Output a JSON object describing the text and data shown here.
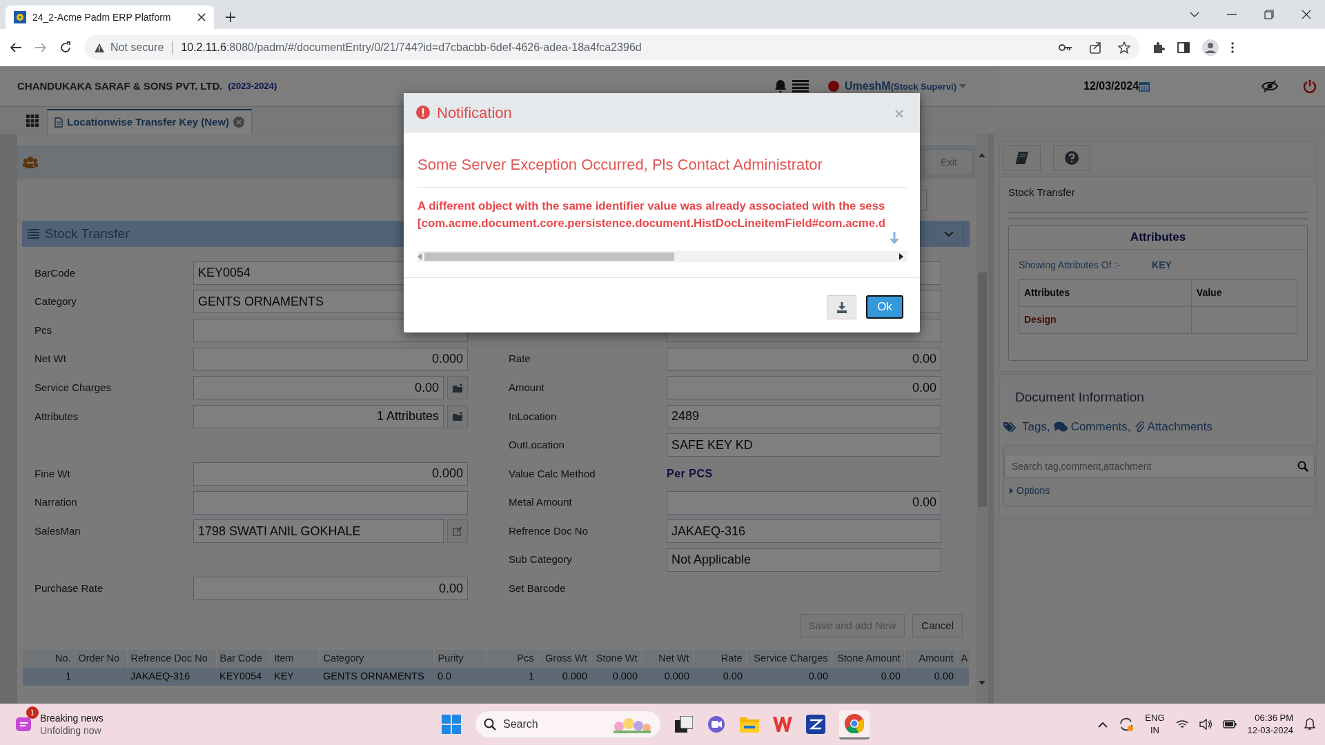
{
  "browser": {
    "tab_title": "24_2-Acme Padm ERP Platform",
    "security": "Not secure",
    "url_host": "10.2.11.6",
    "url_rest": ":8080/padm/#/documentEntry/0/21/744?id=d7cbacbb-6def-4626-adea-18a4fca2396d"
  },
  "header": {
    "company": "CHANDUKAKA SARAF & SONS PVT. LTD.",
    "year": "(2023-2024)",
    "user": "UmeshM",
    "role": "(Stock Supervi)",
    "date": "12/03/2024"
  },
  "doc_tabs": [
    {
      "label": "Locationwise Transfer Key (New)",
      "selected": true
    }
  ],
  "toolbar": {
    "exit": "Exit"
  },
  "section": {
    "title": "Stock Transfer"
  },
  "left_fields": [
    {
      "kind": "text",
      "label": "BarCode",
      "value": "KEY0054"
    },
    {
      "kind": "text",
      "label": "Category",
      "value": "GENTS ORNAMENTS"
    },
    {
      "kind": "number",
      "label": "Pcs"
    },
    {
      "kind": "number",
      "label": "Net Wt",
      "value": "0.000"
    },
    {
      "kind": "number_folder",
      "label": "Service Charges",
      "value": "0.00"
    },
    {
      "kind": "number_folder",
      "label": "Attributes",
      "value": "1 Attributes"
    },
    {
      "kind": "blank"
    },
    {
      "kind": "number",
      "label": "Fine Wt",
      "value": "0.000"
    },
    {
      "kind": "text",
      "label": "Narration"
    },
    {
      "kind": "text_edit",
      "label": "SalesMan",
      "value": "1798 SWATI ANIL GOKHALE"
    },
    {
      "kind": "blank"
    },
    {
      "kind": "number",
      "label": "Purchase Rate",
      "value": "0.00"
    }
  ],
  "right_fields": [
    {
      "kind": "covered"
    },
    {
      "kind": "covered"
    },
    {
      "kind": "covered"
    },
    {
      "kind": "number",
      "label": "Rate",
      "value": "0.00"
    },
    {
      "kind": "number",
      "label": "Amount",
      "value": "0.00"
    },
    {
      "kind": "text",
      "label": "InLocation",
      "value": "2489"
    },
    {
      "kind": "text",
      "label": "OutLocation",
      "value": "SAFE KEY KD"
    },
    {
      "kind": "plain",
      "label": "Value Calc Method",
      "value": "Per PCS"
    },
    {
      "kind": "number",
      "label": "Metal Amount",
      "value": "0.00"
    },
    {
      "kind": "text",
      "label": "Refrence Doc No",
      "value": "JAKAEQ-316"
    },
    {
      "kind": "text",
      "label": "Sub Category",
      "value": "Not Applicable"
    },
    {
      "kind": "label",
      "label": "Set Barcode"
    }
  ],
  "form_buttons": [
    {
      "label": "Save and add New",
      "disabled": true
    },
    {
      "label": "Cancel",
      "disabled": false
    }
  ],
  "table": {
    "columns": [
      "No.",
      "Order No",
      "Refrence Doc No",
      "Bar Code",
      "Item",
      "Category",
      "Purity",
      "Pcs",
      "Gross Wt",
      "Stone Wt",
      "Net Wt",
      "Rate",
      "Service Charges",
      "Stone Amount",
      "Amount",
      "A"
    ],
    "rows": [
      {
        "selected": true,
        "cells": [
          "1",
          null,
          "JAKAEQ-316",
          "KEY0054",
          "KEY",
          "GENTS ORNAMENTS",
          "0.0",
          "1",
          "0.000",
          "0.000",
          "0.000",
          "0.00",
          "0.00",
          "0.00",
          "0.00",
          null
        ]
      }
    ]
  },
  "side_panel": {
    "title": "Stock Transfer",
    "attributes": {
      "title": "Attributes",
      "showing_label": "Showing Attributes Of :-",
      "showing_value": "KEY",
      "columns": [
        "Attributes",
        "Value"
      ],
      "rows": [
        {
          "name": "Design"
        }
      ]
    }
  },
  "document_info": {
    "title": "Document Information",
    "links": [
      "Tags,",
      "Comments,",
      "Attachments"
    ],
    "search_placeholder": "Search tag,comment,attachment",
    "options": "Options"
  },
  "modal": {
    "title": "Notification",
    "message": "Some Server Exception Occurred, Pls Contact Administrator",
    "details": [
      "A different object with the same identifier value was already associated with the sess",
      "[com.acme.document.core.persistence.document.HistDocLineitemField#com.acme.d"
    ],
    "ok": "Ok"
  },
  "taskbar": {
    "news_title": "Breaking news",
    "news_sub": "Unfolding now",
    "badge": "1",
    "search_placeholder": "Search",
    "lang": "ENG",
    "region": "IN",
    "time": "06:36 PM",
    "date": "12-03-2024"
  }
}
